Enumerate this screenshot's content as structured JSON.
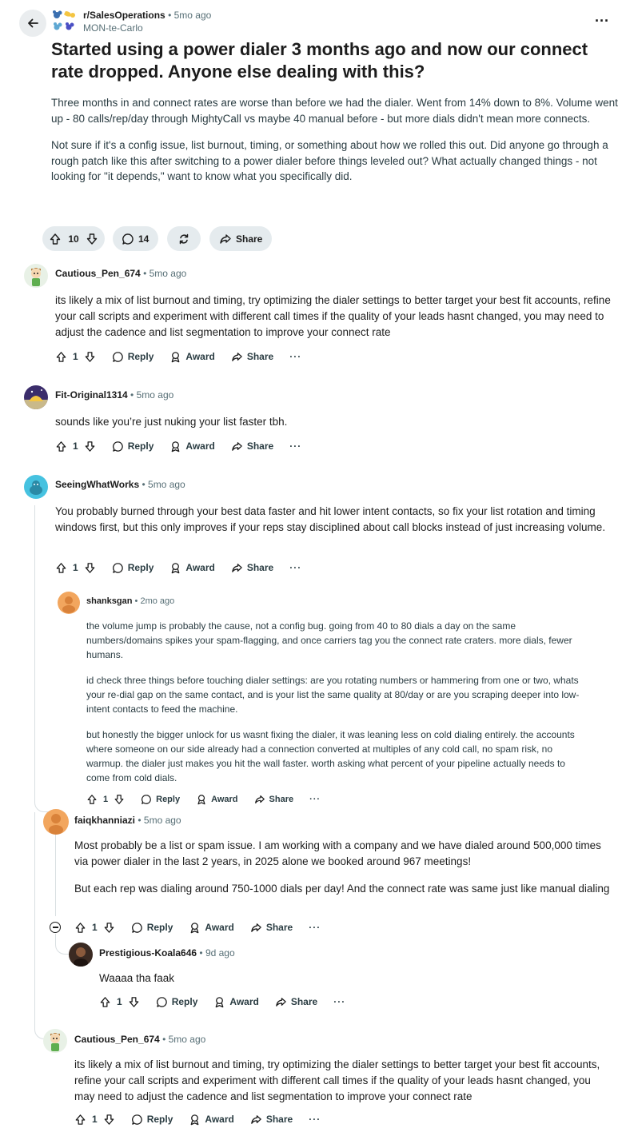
{
  "post": {
    "subreddit": "r/SalesOperations",
    "age": "5mo ago",
    "author": "MON-te-Carlo",
    "title": "Started using a power dialer 3 months ago and now our connect rate dropped. Anyone else dealing with this?",
    "body": [
      "Three months in and connect rates are worse than before we had the dialer. Went from 14% down to 8%. Volume went up - 80 calls/rep/day through MightyCall vs maybe 40 manual before - but more dials didn't mean more connects.",
      "Not sure if it's a config issue, list burnout, timing, or something about how we rolled this out. Did anyone go through a rough patch like this after switching to a power dialer before things leveled out? What actually changed things - not looking for \"it depends,\" want to know what you specifically did."
    ],
    "votes": "10",
    "comments": "14",
    "share_label": "Share",
    "more_label": "···"
  },
  "labels": {
    "reply": "Reply",
    "award": "Award",
    "share": "Share",
    "more": "···",
    "dot": "•"
  },
  "comments": [
    {
      "author": "Cautious_Pen_674",
      "age": "5mo ago",
      "body": [
        "its likely a mix of list burnout and timing, try optimizing the dialer settings to better target your best fit accounts, refine your call scripts and experiment with different call times if the quality of your leads hasnt changed, you may need to adjust the cadence and list segmentation to improve your connect rate"
      ],
      "votes": "1"
    },
    {
      "author": "Fit-Original1314",
      "age": "5mo ago",
      "body": [
        "sounds like you’re just nuking your list faster tbh."
      ],
      "votes": "1"
    },
    {
      "author": "SeeingWhatWorks",
      "age": "5mo ago",
      "body": [
        "You probably burned through your best data faster and hit lower intent contacts, so fix your list rotation and timing windows first, but this only improves if your reps stay disciplined about call blocks instead of just increasing volume."
      ],
      "votes": "1"
    },
    {
      "author": "shanksgan",
      "age": "2mo ago",
      "body": [
        "the volume jump is probably the cause, not a config bug. going from 40 to 80 dials a day on the same numbers/domains spikes your spam-flagging, and once carriers tag you the connect rate craters. more dials, fewer humans.",
        "id check three things before touching dialer settings: are you rotating numbers or hammering from one or two, whats your re-dial gap on the same contact, and is your list the same quality at 80/day or are you scraping deeper into low-intent contacts to feed the machine.",
        "but honestly the bigger unlock for us wasnt fixing the dialer, it was leaning less on cold dialing entirely. the accounts where someone on our side already had a connection converted at multiples of any cold call, no spam risk, no warmup. the dialer just makes you hit the wall faster. worth asking what percent of your pipeline actually needs to come from cold dials."
      ],
      "votes": "1"
    },
    {
      "author": "faiqkhanniazi",
      "age": "5mo ago",
      "body": [
        "Most probably be a list or spam issue. I am working with a company and we have dialed around 500,000 times via power dialer in the last 2 years, in 2025 alone we booked around 967 meetings!",
        "But each rep was dialing around 750-1000 dials per day! And the connect rate was same just like manual dialing"
      ],
      "votes": "1"
    },
    {
      "author": "Prestigious-Koala646",
      "age": "9d ago",
      "body": [
        "Waaaa tha faak"
      ],
      "votes": "1"
    },
    {
      "author": "Cautious_Pen_674",
      "age": "5mo ago",
      "body": [
        "its likely a mix of list burnout and timing, try optimizing the dialer settings to better target your best fit accounts, refine your call scripts and experiment with different call times if the quality of your leads hasnt changed, you may need to adjust the cadence and list segmentation to improve your connect rate"
      ],
      "votes": "1"
    }
  ],
  "colors": {
    "pill_bg": "#e5ebee",
    "meta_text": "#576f76",
    "body_text": "#2a3c42",
    "thread_line": "#d9dfe2"
  },
  "icons": [
    "back-arrow-icon",
    "upvote-icon",
    "downvote-icon",
    "comment-icon",
    "repost-icon",
    "share-icon",
    "award-icon",
    "collapse-icon"
  ]
}
